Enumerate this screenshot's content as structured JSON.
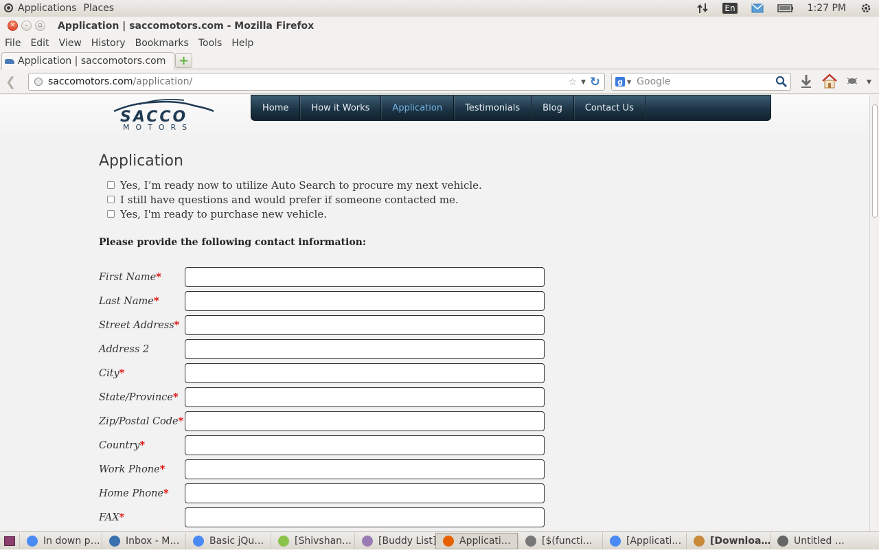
{
  "topbar": {
    "applications": "Applications",
    "places": "Places",
    "lang": "En",
    "time": "1:27 PM"
  },
  "window": {
    "title": "Application | saccomotors.com - Mozilla Firefox"
  },
  "menubar": [
    "File",
    "Edit",
    "View",
    "History",
    "Bookmarks",
    "Tools",
    "Help"
  ],
  "tab": {
    "label": "Application | saccomotors.com"
  },
  "urlbar": {
    "host": "saccomotors.com",
    "path": "/application/"
  },
  "searchbar": {
    "placeholder": "Google"
  },
  "site": {
    "logo_main": "SACCO",
    "logo_sub": "MOTORS",
    "nav": [
      "Home",
      "How it Works",
      "Application",
      "Testimonials",
      "Blog",
      "Contact Us"
    ],
    "nav_active": "Application",
    "accent": "#74b4e6"
  },
  "page": {
    "title": "Application",
    "options": [
      "Yes, I’m ready now to utilize Auto Search to procure my next vehicle.",
      "I still have questions and would prefer if someone contacted me.",
      "Yes, I'm ready to purchase new vehicle."
    ],
    "contact_heading": "Please provide the following contact information:",
    "fields": [
      {
        "label": "First Name",
        "required": true
      },
      {
        "label": "Last Name",
        "required": true
      },
      {
        "label": "Street Address",
        "required": true
      },
      {
        "label": "Address 2",
        "required": false
      },
      {
        "label": "City",
        "required": true
      },
      {
        "label": "State/Province",
        "required": true
      },
      {
        "label": "Zip/Postal Code",
        "required": true
      },
      {
        "label": "Country",
        "required": true
      },
      {
        "label": "Work Phone",
        "required": true
      },
      {
        "label": "Home Phone",
        "required": true
      },
      {
        "label": "FAX",
        "required": true
      }
    ]
  },
  "taskbar": [
    {
      "label": "In down p…",
      "icon": "chrome-icon",
      "color": "#4a8af4"
    },
    {
      "label": "Inbox - M…",
      "icon": "thunderbird-icon",
      "color": "#3a6fb0"
    },
    {
      "label": "Basic jQu…",
      "icon": "chrome-icon",
      "color": "#4a8af4"
    },
    {
      "label": "[Shivshan…",
      "icon": "pidgin-icon",
      "color": "#8bc34a"
    },
    {
      "label": "[Buddy List]",
      "icon": "pidgin-icon",
      "color": "#9b7bb4"
    },
    {
      "label": "Applicati…",
      "icon": "firefox-icon",
      "color": "#e66000",
      "active": true
    },
    {
      "label": "[$(functi…",
      "icon": "editor-icon",
      "color": "#777"
    },
    {
      "label": "[Applicati…",
      "icon": "chrome-icon",
      "color": "#4a8af4"
    },
    {
      "label": "[Downloa…",
      "icon": "download-icon",
      "color": "#c88a3a",
      "bold": true
    },
    {
      "label": "Untitled …",
      "icon": "text-editor-icon",
      "color": "#666"
    }
  ]
}
